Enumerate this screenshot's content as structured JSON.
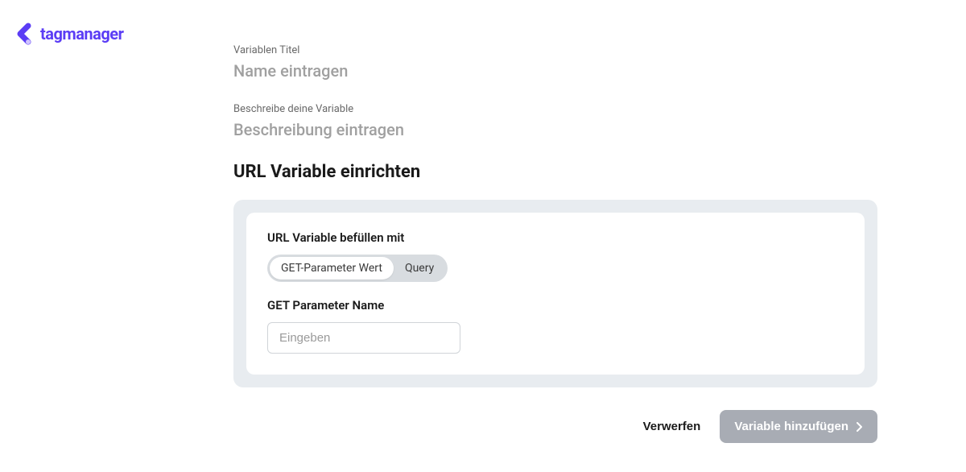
{
  "logo": {
    "text": "tagmanager",
    "color": "#5b3df5"
  },
  "form": {
    "title_label": "Variablen Titel",
    "title_placeholder": "Name eintragen",
    "description_label": "Beschreibe deine Variable",
    "description_placeholder": "Beschreibung eintragen",
    "section_title": "URL Variable einrichten",
    "card": {
      "fill_label": "URL Variable befüllen mit",
      "pills": {
        "option_a": "GET-Parameter Wert",
        "option_b": "Query"
      },
      "param_label": "GET Parameter Name",
      "param_placeholder": "Eingeben"
    }
  },
  "actions": {
    "discard": "Verwerfen",
    "add": "Variable hinzufügen"
  }
}
